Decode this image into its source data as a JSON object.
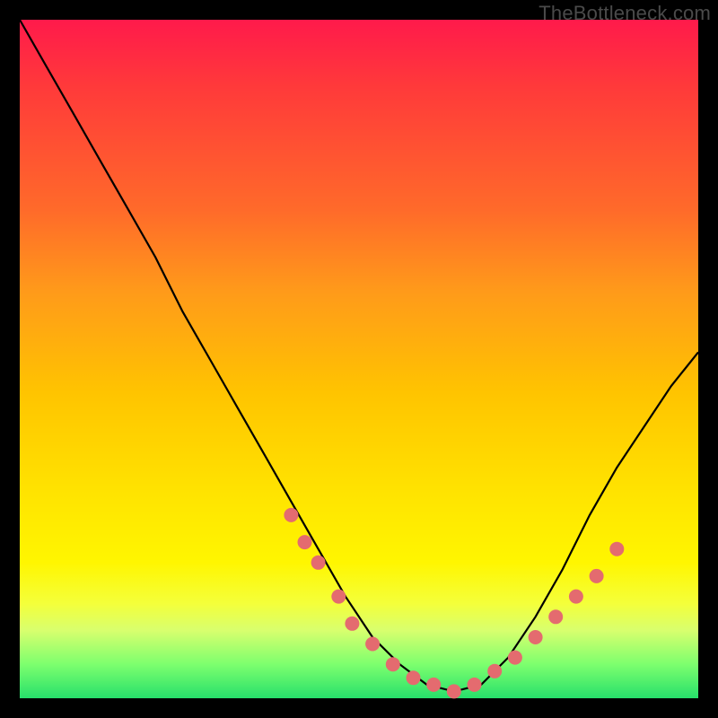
{
  "watermark": "TheBottleneck.com",
  "colors": {
    "frame": "#000000",
    "gradient_top": "#ff1a4b",
    "gradient_bottom": "#27e06b",
    "curve": "#000000",
    "dots": "#e46b6f"
  },
  "chart_data": {
    "type": "line",
    "title": "",
    "xlabel": "",
    "ylabel": "",
    "xlim": [
      0,
      100
    ],
    "ylim": [
      0,
      100
    ],
    "x": [
      0,
      4,
      8,
      12,
      16,
      20,
      24,
      28,
      32,
      36,
      40,
      44,
      48,
      52,
      56,
      60,
      64,
      68,
      72,
      76,
      80,
      84,
      88,
      92,
      96,
      100
    ],
    "series": [
      {
        "name": "bottleneck-curve",
        "values": [
          100,
          93,
          86,
          79,
          72,
          65,
          57,
          50,
          43,
          36,
          29,
          22,
          15,
          9,
          5,
          2,
          1,
          2,
          6,
          12,
          19,
          27,
          34,
          40,
          46,
          51
        ]
      }
    ],
    "markers": {
      "name": "highlight-dots",
      "x": [
        40,
        42,
        44,
        47,
        49,
        52,
        55,
        58,
        61,
        64,
        67,
        70,
        73,
        76,
        79,
        82,
        85,
        88
      ],
      "values": [
        27,
        23,
        20,
        15,
        11,
        8,
        5,
        3,
        2,
        1,
        2,
        4,
        6,
        9,
        12,
        15,
        18,
        22
      ]
    }
  }
}
